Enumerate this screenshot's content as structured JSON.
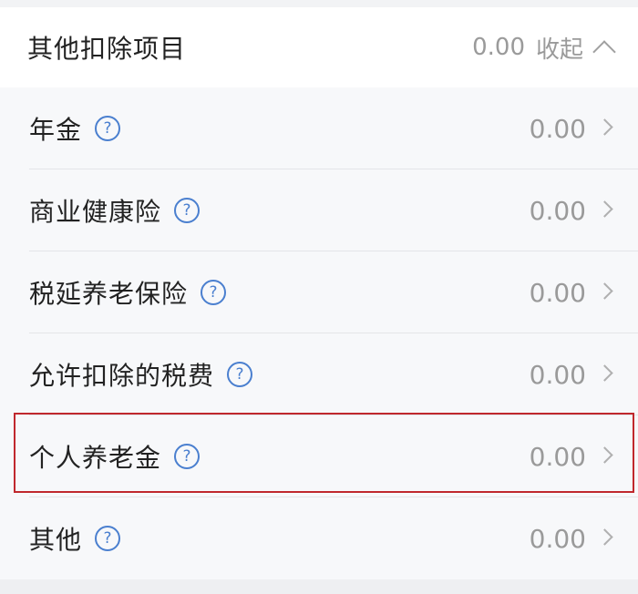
{
  "header": {
    "title": "其他扣除项目",
    "total": "0.00",
    "toggle_label": "收起",
    "toggle_icon": "chevron-up-icon"
  },
  "rows": [
    {
      "label": "年金",
      "value": "0.00"
    },
    {
      "label": "商业健康险",
      "value": "0.00"
    },
    {
      "label": "税延养老保险",
      "value": "0.00"
    },
    {
      "label": "允许扣除的税费",
      "value": "0.00"
    },
    {
      "label": "个人养老金",
      "value": "0.00"
    },
    {
      "label": "其他",
      "value": "0.00"
    }
  ],
  "help_glyph": "?",
  "colors": {
    "accent_blue": "#4a7fcf",
    "highlight_red": "#c0282d",
    "text_primary": "#222222",
    "text_secondary": "#9a9a9a"
  },
  "highlighted_row": "个人养老金"
}
